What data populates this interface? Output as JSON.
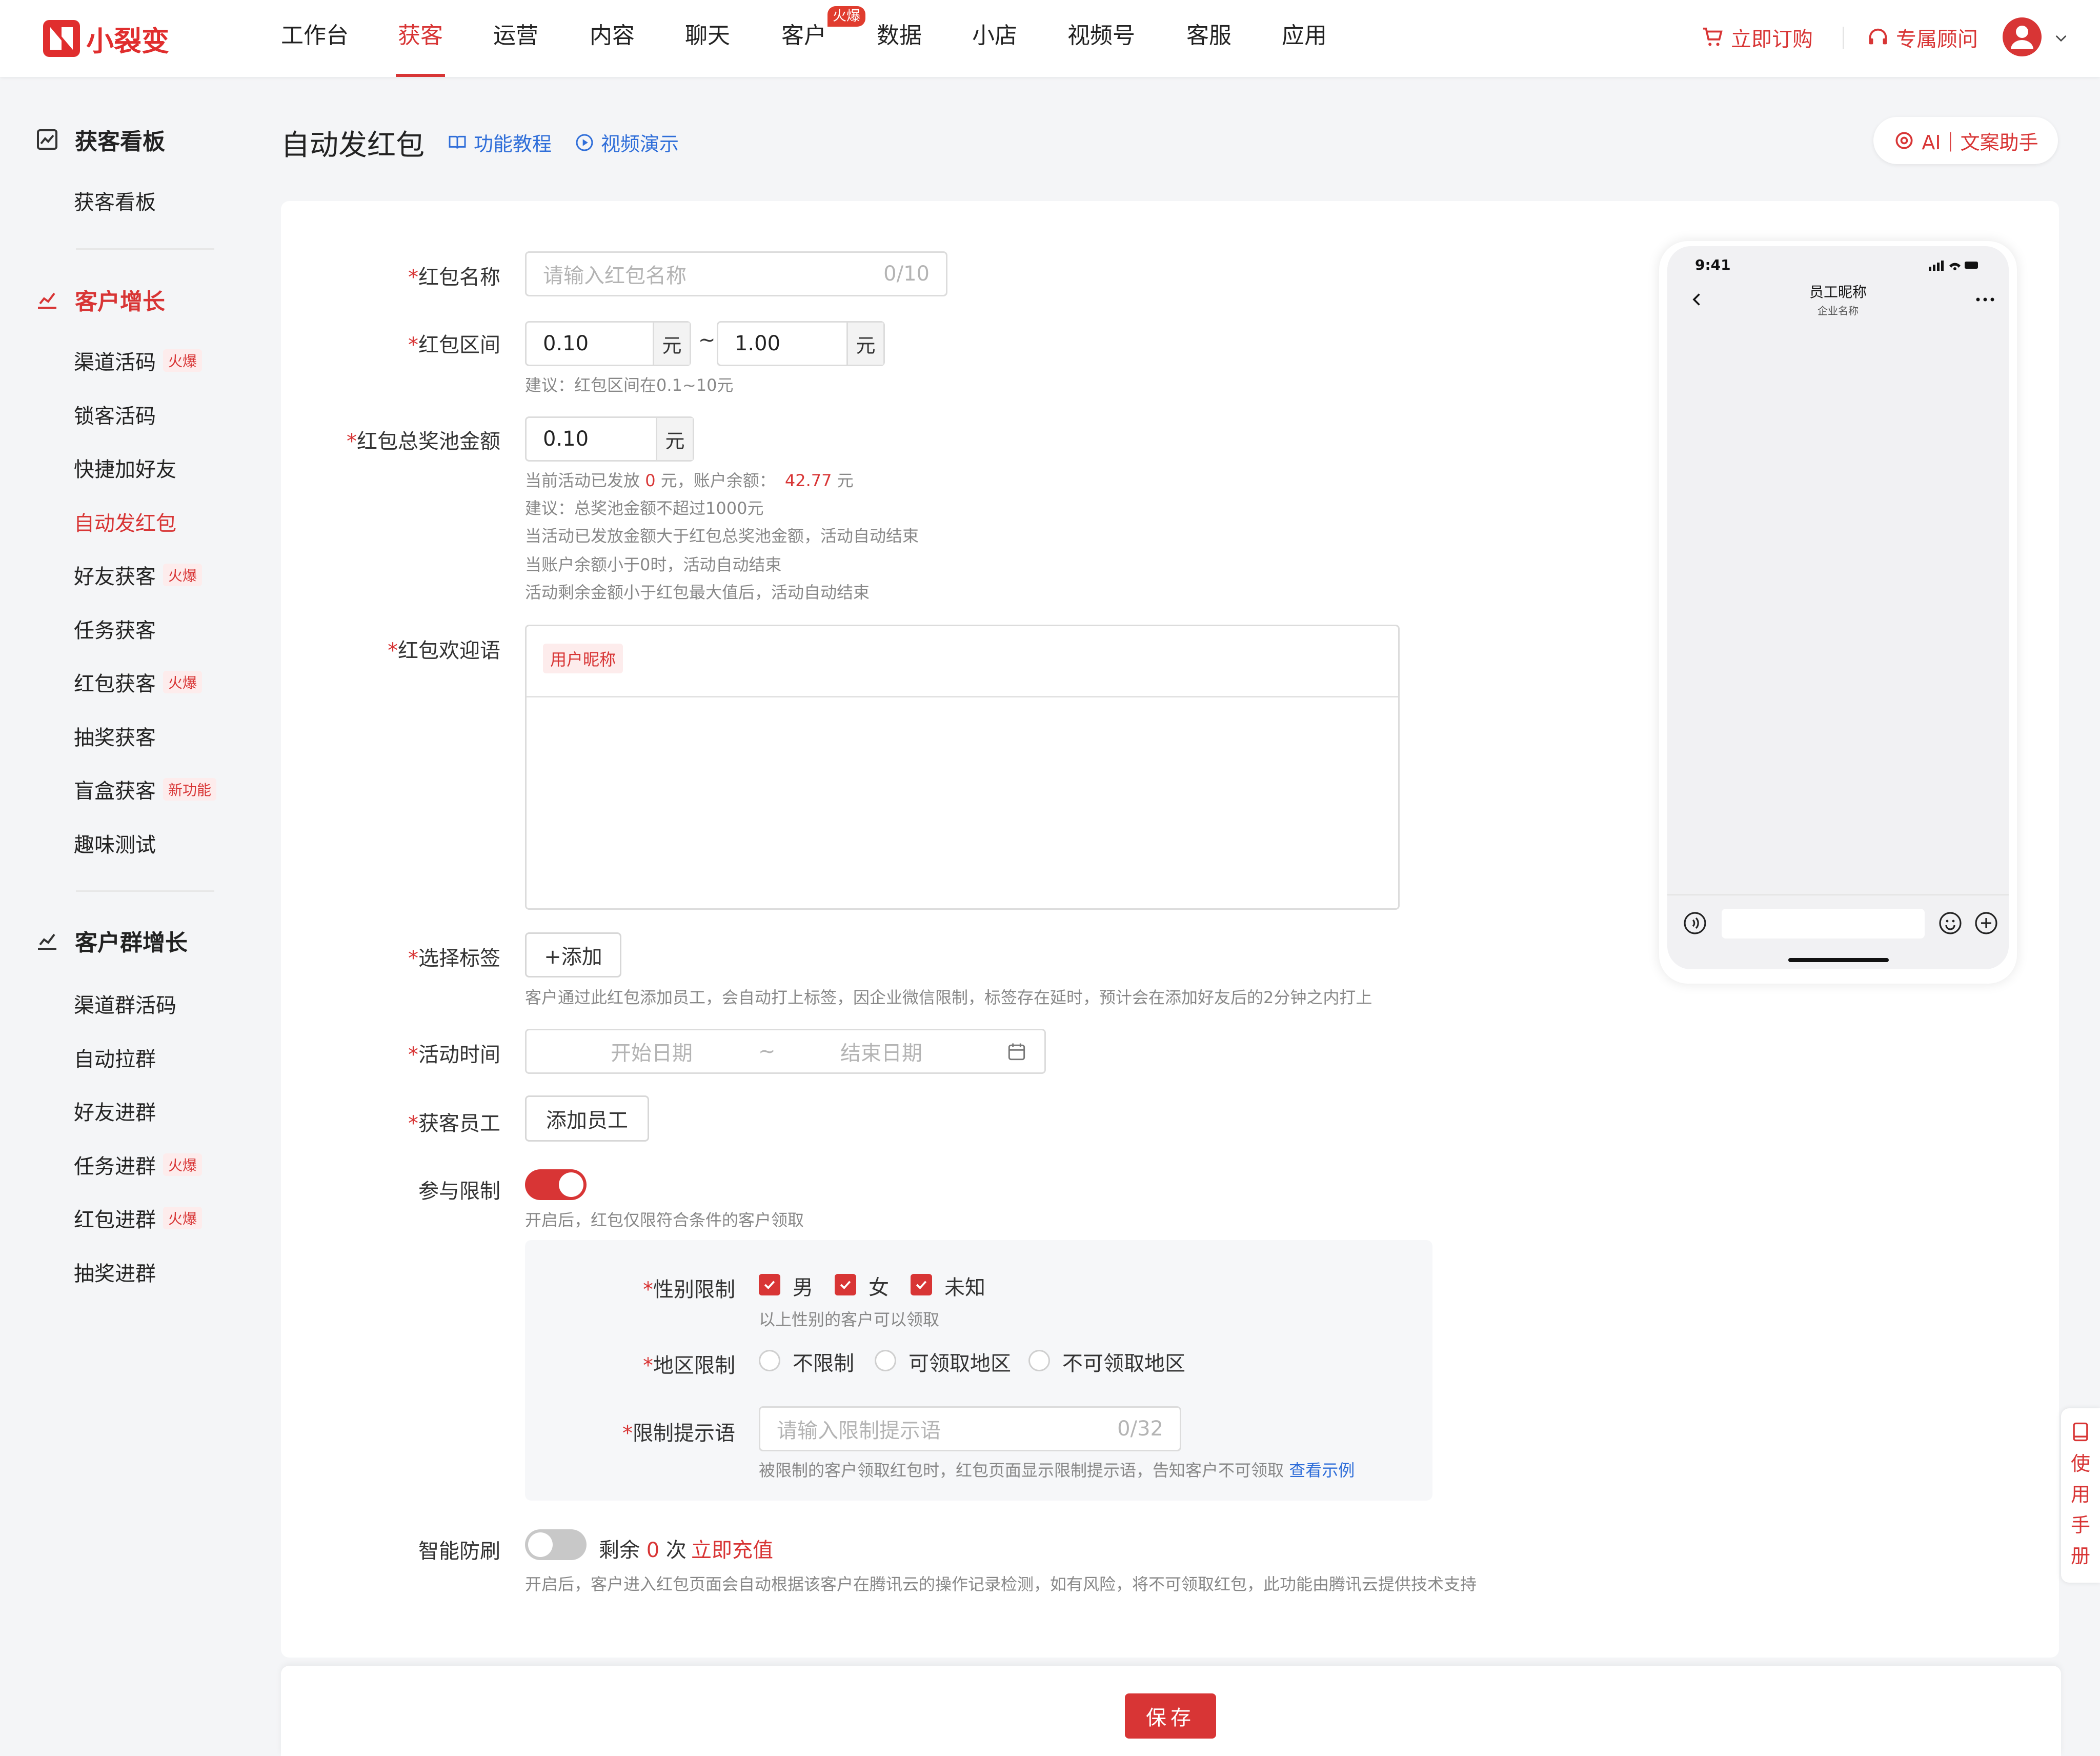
{
  "app": {
    "logo_text": "小裂变"
  },
  "nav": {
    "items": [
      "工作台",
      "获客",
      "运营",
      "内容",
      "聊天",
      "客户",
      "数据",
      "小店",
      "视频号",
      "客服",
      "应用"
    ],
    "active": "获客",
    "hot_badge": "火爆"
  },
  "topright": {
    "order": "立即订购",
    "consultant": "专属顾问"
  },
  "sidebar": {
    "sec1": {
      "title": "获客看板",
      "items": [
        {
          "label": "获客看板"
        }
      ]
    },
    "sec2": {
      "title": "客户增长",
      "items": [
        {
          "label": "渠道活码",
          "tag": "火爆"
        },
        {
          "label": "锁客活码"
        },
        {
          "label": "快捷加好友"
        },
        {
          "label": "自动发红包"
        },
        {
          "label": "好友获客",
          "tag": "火爆"
        },
        {
          "label": "任务获客"
        },
        {
          "label": "红包获客",
          "tag": "火爆"
        },
        {
          "label": "抽奖获客"
        },
        {
          "label": "盲盒获客",
          "tag": "新功能"
        },
        {
          "label": "趣味测试"
        }
      ]
    },
    "sec3": {
      "title": "客户群增长",
      "items": [
        {
          "label": "渠道群活码"
        },
        {
          "label": "自动拉群"
        },
        {
          "label": "好友进群"
        },
        {
          "label": "任务进群",
          "tag": "火爆"
        },
        {
          "label": "红包进群",
          "tag": "火爆"
        },
        {
          "label": "抽奖进群"
        }
      ]
    }
  },
  "page": {
    "title": "自动发红包",
    "tutorial": "功能教程",
    "video": "视频演示",
    "ai": "AI｜文案助手"
  },
  "form": {
    "name": {
      "label": "红包名称",
      "placeholder": "请输入红包名称",
      "counter": "0/10"
    },
    "range": {
      "label": "红包区间",
      "min": "0.10",
      "max": "1.00",
      "unit": "元",
      "sep": "~",
      "hint": "建议：红包区间在0.1~10元"
    },
    "pool": {
      "label": "红包总奖池金额",
      "value": "0.10",
      "unit": "元",
      "issued_prefix": "当前活动已发放",
      "issued": "0",
      "issued_unit": "元，账户余额：",
      "balance": "42.77",
      "balance_unit": "元",
      "hints": [
        "建议：总奖池金额不超过1000元",
        "当活动已发放金额大于红包总奖池金额，活动自动结束",
        "当账户余额小于0时，活动自动结束",
        "活动剩余金额小于红包最大值后，活动自动结束"
      ]
    },
    "greeting": {
      "label": "红包欢迎语",
      "chip": "用户昵称"
    },
    "tags": {
      "label": "选择标签",
      "button": "+添加",
      "hint": "客户通过此红包添加员工，会自动打上标签，因企业微信限制，标签存在延时，预计会在添加好友后的2分钟之内打上"
    },
    "time": {
      "label": "活动时间",
      "start": "开始日期",
      "sep": "~",
      "end": "结束日期"
    },
    "staff": {
      "label": "获客员工",
      "button": "添加员工"
    },
    "limit": {
      "label": "参与限制",
      "on": true,
      "hint": "开启后，红包仅限符合条件的客户领取",
      "gender": {
        "label": "性别限制",
        "options": [
          "男",
          "女",
          "未知"
        ],
        "checked": [
          true,
          true,
          true
        ],
        "hint": "以上性别的客户可以领取"
      },
      "region": {
        "label": "地区限制",
        "options": [
          "不限制",
          "可领取地区",
          "不可领取地区"
        ]
      },
      "tip": {
        "label": "限制提示语",
        "placeholder": "请输入限制提示语",
        "counter": "0/32",
        "hint": "被限制的客户领取红包时，红包页面显示限制提示语，告知客户不可领取",
        "example": "查看示例"
      }
    },
    "antifraud": {
      "label": "智能防刷",
      "on": false,
      "remain_prefix": "剩余",
      "remain": "0",
      "remain_unit": "次",
      "recharge": "立即充值",
      "hint": "开启后，客户进入红包页面会自动根据该客户在腾讯云的操作记录检测，如有风险，将不可领取红包，此功能由腾讯云提供技术支持"
    }
  },
  "phone": {
    "time": "9:41",
    "nickname": "员工昵称",
    "company": "企业名称"
  },
  "footer": {
    "save": "保存"
  },
  "manual": {
    "chars": [
      "使",
      "用",
      "手",
      "册"
    ]
  },
  "colors": {
    "accent": "#d83535",
    "link": "#2f6ed9"
  }
}
